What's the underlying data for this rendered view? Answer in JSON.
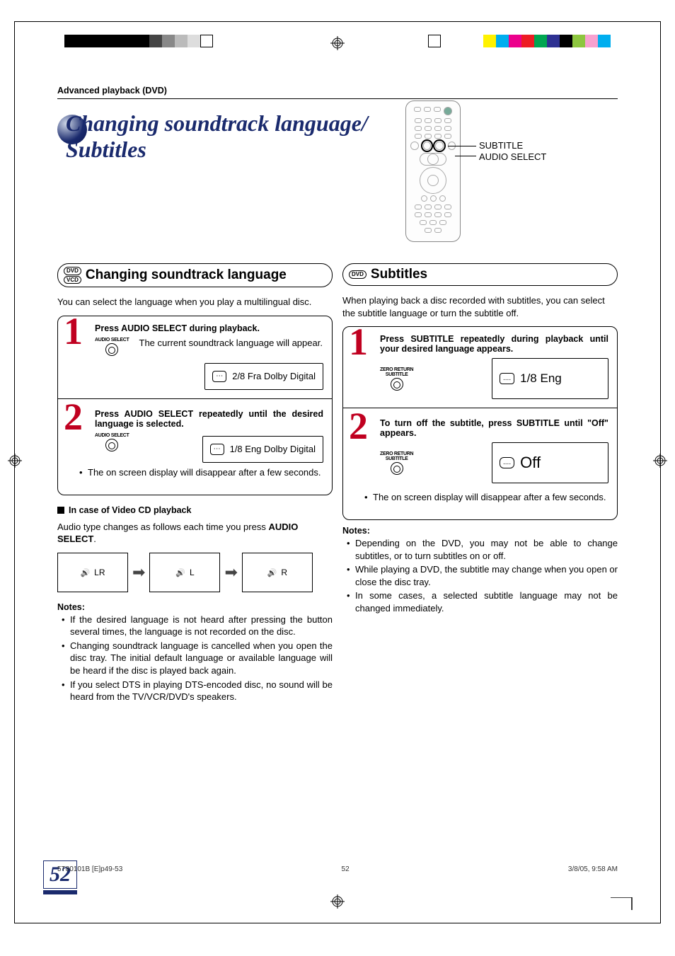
{
  "header_section": "Advanced playback (DVD)",
  "page_title_line1": "Changing soundtrack language/",
  "page_title_line2": "Subtitles",
  "remote_labels": {
    "subtitle": "SUBTITLE",
    "audio_select": "AUDIO SELECT"
  },
  "left": {
    "badge1": "DVD",
    "badge2": "VCD",
    "section_title": "Changing soundtrack language",
    "intro": "You can select the language when you play a multilingual disc.",
    "step1_title": "Press AUDIO SELECT during playback.",
    "step1_btn": "AUDIO SELECT",
    "step1_body": "The current soundtrack language will appear.",
    "step1_osd": "2/8 Fra Dolby Digital",
    "step2_title": "Press AUDIO SELECT repeatedly until the desired language is selected.",
    "step2_btn": "AUDIO SELECT",
    "step2_osd": "1/8 Eng Dolby Digital",
    "step_note": "The on screen display will disappear after a few seconds.",
    "vcd_heading": "In case of Video CD playback",
    "vcd_text_a": "Audio type changes as follows each time you press ",
    "vcd_text_b": "AUDIO SELECT",
    "vcd_text_c": ".",
    "cycle": [
      "LR",
      "L",
      "R"
    ],
    "notes_title": "Notes:",
    "notes": [
      "If the desired language is not heard after pressing the button several times, the language is not recorded on the disc.",
      "Changing soundtrack language is cancelled when you open the disc tray. The initial default language or available language will be heard if the disc is played back again.",
      "If you select DTS in playing DTS-encoded disc, no sound will be heard from the TV/VCR/DVD's speakers."
    ]
  },
  "right": {
    "badge1": "DVD",
    "section_title": "Subtitles",
    "intro": "When playing back a disc recorded with subtitles, you can select the subtitle language or turn the subtitle off.",
    "step1_title": "Press SUBTITLE repeatedly during playback until your desired language appears.",
    "step1_btn_a": "ZERO RETURN",
    "step1_btn_b": "SUBTITLE",
    "step1_osd": "1/8 Eng",
    "step2_title": "To turn off the subtitle, press SUBTITLE until \"Off\" appears.",
    "step2_osd": "Off",
    "step_note": "The on screen display will disappear after a few seconds.",
    "notes_title": "Notes:",
    "notes": [
      "Depending on the DVD, you may not be able to change subtitles, or to turn subtitles on or off.",
      "While playing a DVD, the subtitle may change when you open or close the disc tray.",
      "In some cases, a selected subtitle language may not be changed immediately."
    ]
  },
  "page_number": "52",
  "footer": {
    "file": "5T80101B [E]p49-53",
    "pg": "52",
    "date": "3/8/05, 9:58 AM"
  }
}
